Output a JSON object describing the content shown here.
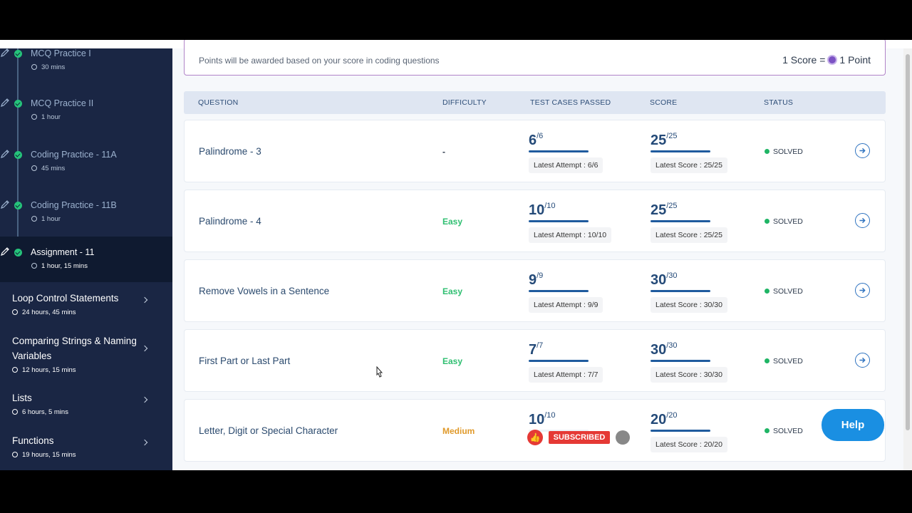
{
  "sidebar": {
    "subitems": [
      {
        "title": "MCQ Practice I",
        "duration": "30 mins",
        "active": false
      },
      {
        "title": "MCQ Practice II",
        "duration": "1 hour",
        "active": false
      },
      {
        "title": "Coding Practice - 11A",
        "duration": "45 mins",
        "active": false
      },
      {
        "title": "Coding Practice - 11B",
        "duration": "1 hour",
        "active": false
      },
      {
        "title": "Assignment - 11",
        "duration": "1 hour, 15 mins",
        "active": true
      }
    ],
    "topics": [
      {
        "title": "Loop Control Statements",
        "duration": "24 hours, 45 mins"
      },
      {
        "title": "Comparing Strings & Naming Variables",
        "duration": "12 hours, 15 mins"
      },
      {
        "title": "Lists",
        "duration": "6 hours, 5 mins"
      },
      {
        "title": "Functions",
        "duration": "19 hours, 15 mins"
      }
    ]
  },
  "points_banner": {
    "text": "Points will be awarded based on your score in coding questions",
    "left_part": "1 Score =",
    "right_part": "1 Point"
  },
  "table": {
    "headers": {
      "question": "QUESTION",
      "difficulty": "DIFFICULTY",
      "test_cases": "TEST CASES PASSED",
      "score": "SCORE",
      "status": "STATUS"
    },
    "rows": [
      {
        "question": "Palindrome - 3",
        "difficulty": "-",
        "difficulty_color": "#2d3a4c",
        "passed": "6",
        "total_cases": "/6",
        "attempt": "Latest Attempt : 6/6",
        "score": "25",
        "score_total": "/25",
        "latest_score": "Latest Score : 25/25",
        "status": "SOLVED"
      },
      {
        "question": "Palindrome - 4",
        "difficulty": "Easy",
        "difficulty_color": "#2fbf71",
        "passed": "10",
        "total_cases": "/10",
        "attempt": "Latest Attempt : 10/10",
        "score": "25",
        "score_total": "/25",
        "latest_score": "Latest Score : 25/25",
        "status": "SOLVED"
      },
      {
        "question": "Remove Vowels in a Sentence",
        "difficulty": "Easy",
        "difficulty_color": "#2fbf71",
        "passed": "9",
        "total_cases": "/9",
        "attempt": "Latest Attempt : 9/9",
        "score": "30",
        "score_total": "/30",
        "latest_score": "Latest Score : 30/30",
        "status": "SOLVED"
      },
      {
        "question": "First Part or Last Part",
        "difficulty": "Easy",
        "difficulty_color": "#2fbf71",
        "passed": "7",
        "total_cases": "/7",
        "attempt": "Latest Attempt : 7/7",
        "score": "30",
        "score_total": "/30",
        "latest_score": "Latest Score : 30/30",
        "status": "SOLVED"
      },
      {
        "question": "Letter, Digit or Special Character",
        "difficulty": "Medium",
        "difficulty_color": "#e09a2b",
        "passed": "10",
        "total_cases": "/10",
        "attempt": "",
        "score": "20",
        "score_total": "/20",
        "latest_score": "Latest Score : 20/20",
        "status": "SOLVED"
      }
    ]
  },
  "help_label": "Help",
  "overlay": {
    "subscribe_label": "SUBSCRIBED"
  },
  "colors": {
    "sidebar_bg": "#1a2644",
    "accent": "#1f5b9e",
    "success": "#1fb565",
    "help": "#1a8fe2"
  }
}
